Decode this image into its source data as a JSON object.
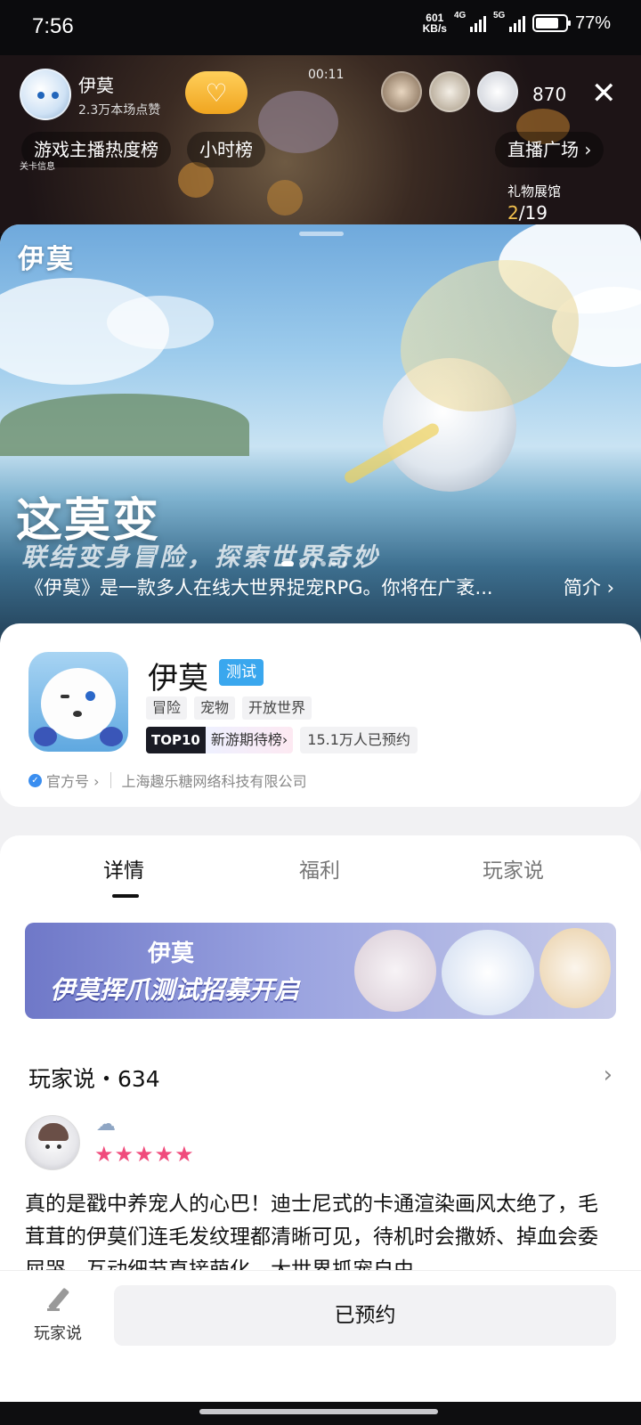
{
  "status_bar": {
    "time": "7:56",
    "net_speed_value": "601",
    "net_speed_unit": "KB/s",
    "signal1_label": "4G",
    "signal2_label": "5G",
    "battery_percent": "77%",
    "battery_level": 0.77
  },
  "live": {
    "streamer_name": "伊莫",
    "likes": "2.3万本场点赞",
    "timer": "00:11",
    "viewer_count": "870",
    "tabs": [
      "游戏主播热度榜",
      "小时榜",
      "直播广场"
    ],
    "gift_title": "礼物展馆",
    "gift_current": "2",
    "gift_total": "/19",
    "level_info_title": "关卡信息"
  },
  "hero": {
    "logo": "伊莫",
    "slogan": "这莫变",
    "subslogan": "联结变身冒险，探索世界奇妙",
    "description": "《伊莫》是一款多人在线大世界捉宠RPG。你将在广袤...",
    "intro_link": "简介"
  },
  "game": {
    "title": "伊莫",
    "badge": "测试",
    "tags": [
      "冒险",
      "宠物",
      "开放世界"
    ],
    "rank_top": "TOP10",
    "rank_list": "新游期待榜",
    "reserve_count": "15.1万人已预约",
    "official_label": "官方号",
    "developer": "上海趣乐糖网络科技有限公司"
  },
  "tabs": {
    "detail": "详情",
    "welfare": "福利",
    "players": "玩家说"
  },
  "promo": {
    "logo": "伊莫",
    "title": "伊莫挥爪测试招募开启"
  },
  "reviews": {
    "header": "玩家说・634",
    "first": {
      "rating": 5,
      "stars": "★★★★★",
      "text": "真的是戳中养宠人的心巴！迪士尼式的卡通渲染画风太绝了，毛茸茸的伊莫们连毛发纹理都清晰可见，待机时会撒娇、掉血会委屈哭，互动细节直接萌化。大世界抓宠自由"
    }
  },
  "bottom": {
    "player_label": "玩家说",
    "reserved_label": "已预约"
  }
}
